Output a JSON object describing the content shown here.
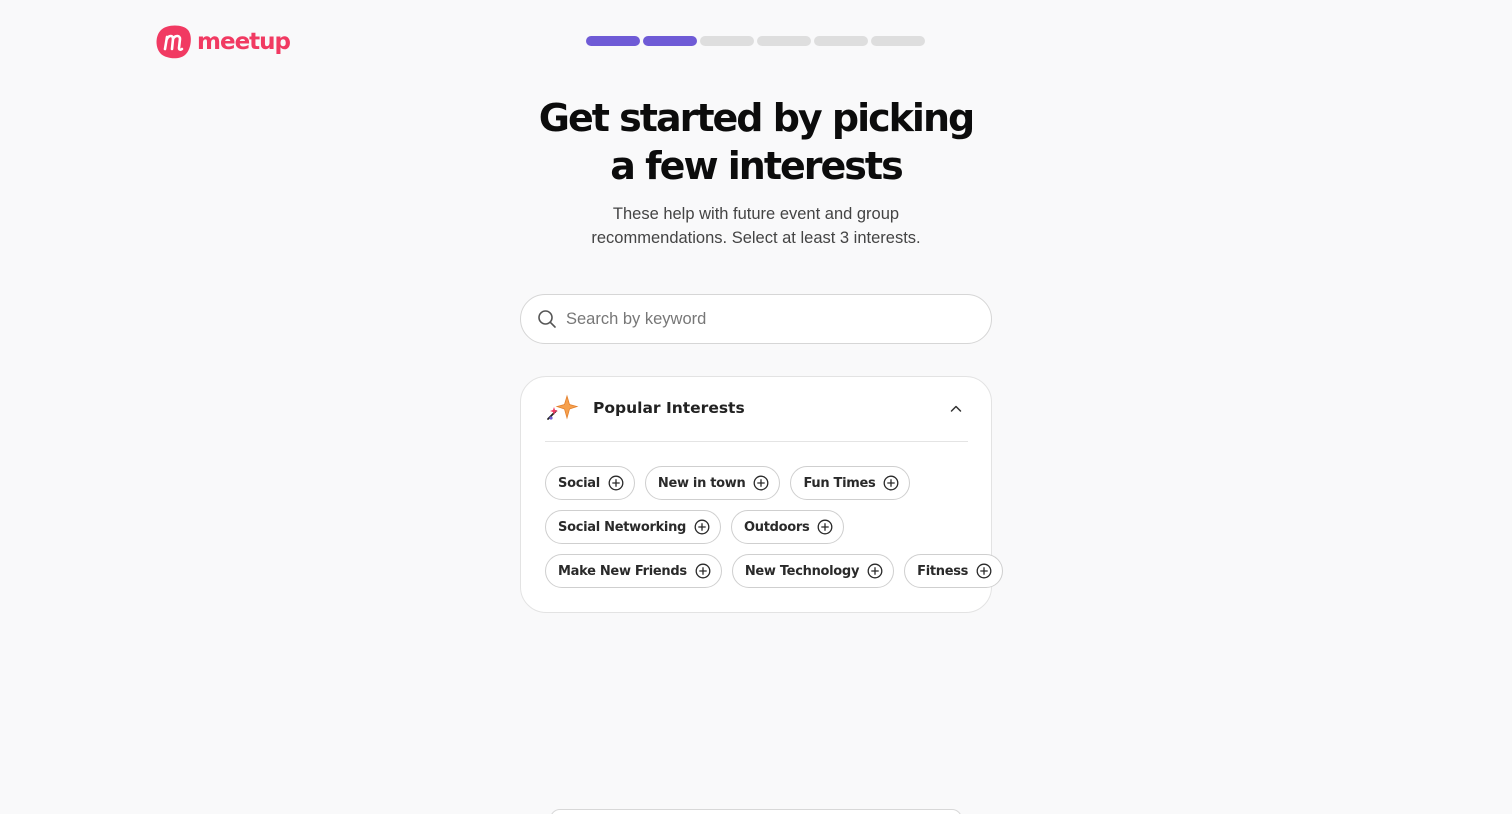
{
  "brand": {
    "name": "meetup",
    "color": "#f13a62"
  },
  "progress": {
    "total_steps": 6,
    "completed_steps": 2,
    "active_color": "#6f5bd6",
    "inactive_color": "#dedede"
  },
  "heading": {
    "line1": "Get started by picking",
    "line2": "a few interests"
  },
  "subtitle": {
    "line1": "These help with future event and group",
    "line2": "recommendations. Select at least 3 interests."
  },
  "search": {
    "placeholder": "Search by keyword",
    "value": "",
    "icon": "search-icon"
  },
  "popular": {
    "title": "Popular Interests",
    "icon": "sparkle-icon",
    "expanded": true,
    "rows": [
      [
        {
          "label": "Social"
        },
        {
          "label": "New in town"
        },
        {
          "label": "Fun Times"
        }
      ],
      [
        {
          "label": "Social Networking"
        },
        {
          "label": "Outdoors"
        }
      ],
      [
        {
          "label": "Make New Friends"
        },
        {
          "label": "New Technology"
        },
        {
          "label": "Fitness"
        }
      ]
    ]
  }
}
